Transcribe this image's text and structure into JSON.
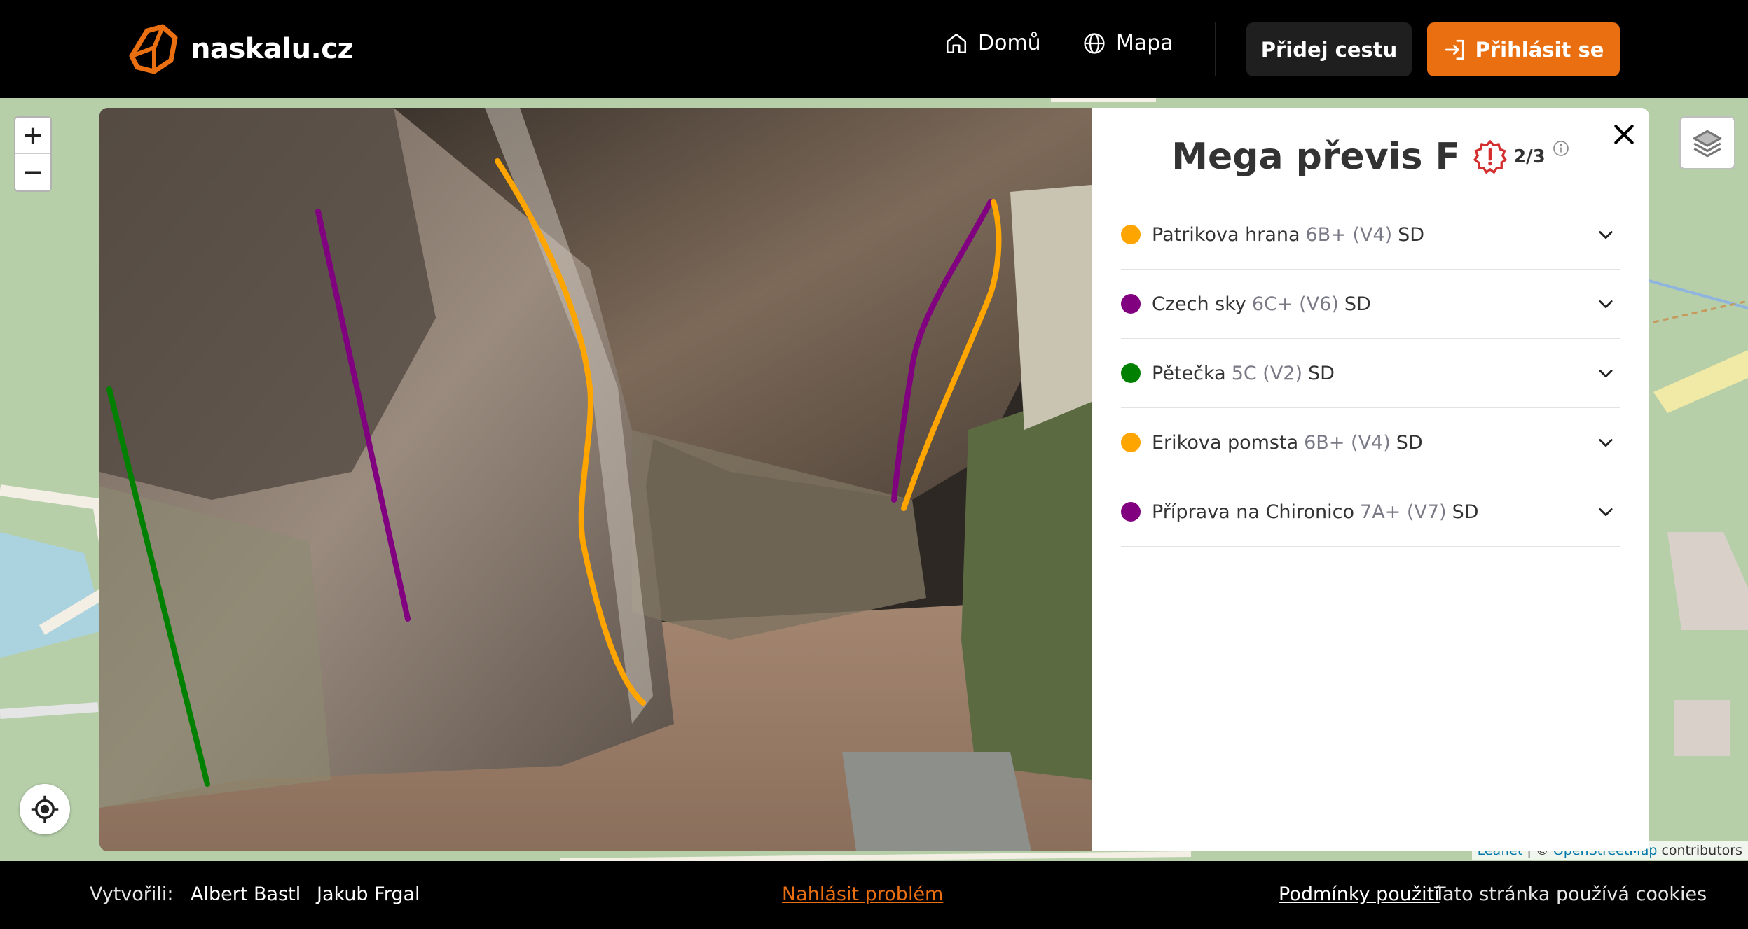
{
  "header": {
    "logo_text": "naskalu.cz",
    "nav": [
      {
        "label": "Domů",
        "icon": "home-icon"
      },
      {
        "label": "Mapa",
        "icon": "globe-icon"
      }
    ],
    "add_route_label": "Přidej cestu",
    "login_label": "Přihlásit se",
    "accent_color": "#ea6f10"
  },
  "map": {
    "zoom_in": "+",
    "zoom_out": "−",
    "attribution": {
      "leaflet": "Leaflet",
      "sep": " | © ",
      "osm": "OpenStreetMap",
      "rest": " contributors"
    }
  },
  "boulder": {
    "title": "Mega převis F",
    "warning_count": "2/3",
    "routes": [
      {
        "name": "Patrikova hrana",
        "grade": "6B+ (V4)",
        "start": "SD",
        "color": "#ffa500"
      },
      {
        "name": "Czech sky",
        "grade": "6C+ (V6)",
        "start": "SD",
        "color": "#800080"
      },
      {
        "name": "Pětečka",
        "grade": "5C (V2)",
        "start": "SD",
        "color": "#008000"
      },
      {
        "name": "Erikova pomsta",
        "grade": "6B+ (V4)",
        "start": "SD",
        "color": "#ffa500"
      },
      {
        "name": "Příprava na Chironico",
        "grade": "7A+ (V7)",
        "start": "SD",
        "color": "#800080"
      }
    ]
  },
  "footer": {
    "created_by_label": "Vytvořili:",
    "authors": [
      "Albert Bastl",
      "Jakub Frgal"
    ],
    "report_label": "Nahlásit problém",
    "terms_label": "Podmínky použití",
    "cookies_label": "Tato stránka používá cookies"
  }
}
